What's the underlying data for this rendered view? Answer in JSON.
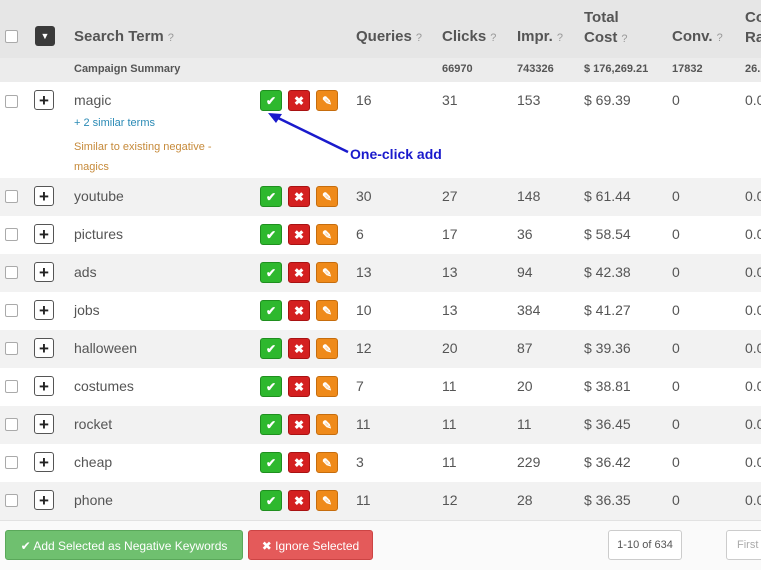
{
  "header": {
    "search_term": "Search Term",
    "queries": "Queries",
    "clicks": "Clicks",
    "impr": "Impr.",
    "total_cost_line1": "Total",
    "total_cost_line2": "Cost",
    "conv": "Conv.",
    "conv_rate_line1": "Co",
    "conv_rate_line2": "Ra",
    "help_mark": "?",
    "dropdown_glyph": "▼"
  },
  "summary": {
    "label": "Campaign Summary",
    "clicks": "66970",
    "impr": "743326",
    "cost": "$ 176,269.21",
    "conv": "17832",
    "rate": "26."
  },
  "buttons": {
    "plus": "+",
    "accept": "✔",
    "reject": "✖",
    "edit": "✎"
  },
  "rows": [
    {
      "term": "magic",
      "queries": "16",
      "clicks": "31",
      "impr": "153",
      "cost": "$ 69.39",
      "conv": "0",
      "rate": "0.0"
    },
    {
      "term": "youtube",
      "queries": "30",
      "clicks": "27",
      "impr": "148",
      "cost": "$ 61.44",
      "conv": "0",
      "rate": "0.0"
    },
    {
      "term": "pictures",
      "queries": "6",
      "clicks": "17",
      "impr": "36",
      "cost": "$ 58.54",
      "conv": "0",
      "rate": "0.0"
    },
    {
      "term": "ads",
      "queries": "13",
      "clicks": "13",
      "impr": "94",
      "cost": "$ 42.38",
      "conv": "0",
      "rate": "0.0"
    },
    {
      "term": "jobs",
      "queries": "10",
      "clicks": "13",
      "impr": "384",
      "cost": "$ 41.27",
      "conv": "0",
      "rate": "0.0"
    },
    {
      "term": "halloween",
      "queries": "12",
      "clicks": "20",
      "impr": "87",
      "cost": "$ 39.36",
      "conv": "0",
      "rate": "0.0"
    },
    {
      "term": "costumes",
      "queries": "7",
      "clicks": "11",
      "impr": "20",
      "cost": "$ 38.81",
      "conv": "0",
      "rate": "0.0"
    },
    {
      "term": "rocket",
      "queries": "11",
      "clicks": "11",
      "impr": "11",
      "cost": "$ 36.45",
      "conv": "0",
      "rate": "0.0"
    },
    {
      "term": "cheap",
      "queries": "3",
      "clicks": "11",
      "impr": "229",
      "cost": "$ 36.42",
      "conv": "0",
      "rate": "0.0"
    },
    {
      "term": "phone",
      "queries": "11",
      "clicks": "12",
      "impr": "28",
      "cost": "$ 36.35",
      "conv": "0",
      "rate": "0.0"
    }
  ],
  "magic_details": {
    "similar": "+ 2 similar terms",
    "warning": "Similar to existing negative - magics"
  },
  "annotation": "One-click add",
  "footer": {
    "add_label": "Add Selected as Negative Keywords",
    "ignore_label": "Ignore Selected",
    "page_info": "1-10 of 634",
    "first_label": "First"
  },
  "colors": {
    "accept": "#2eb82e",
    "reject": "#d42020",
    "edit": "#ef8a1a",
    "add_button": "#6fc06f",
    "ignore_button": "#e45a5a",
    "annotation": "#1a1acc"
  }
}
